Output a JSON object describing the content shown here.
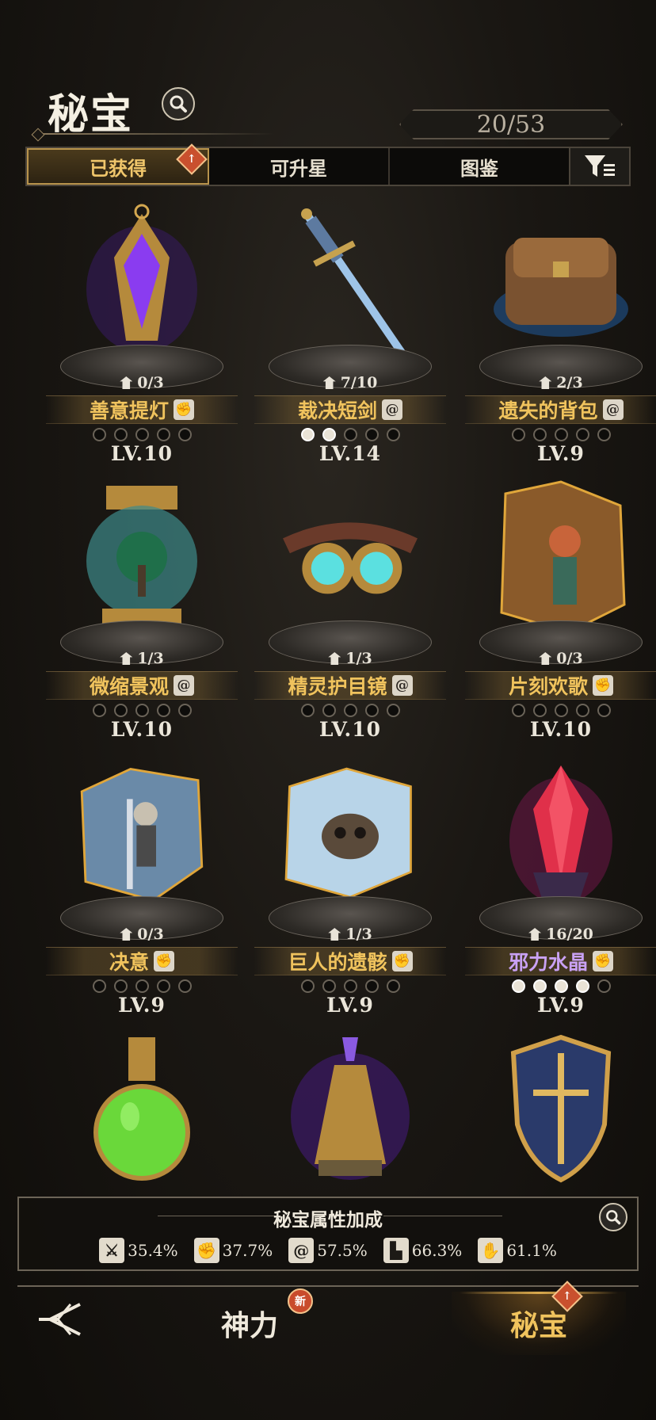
{
  "header": {
    "title": "秘宝",
    "counter": "20/53"
  },
  "tabs": [
    {
      "label": "已获得",
      "active": true,
      "badge": "up-arrow"
    },
    {
      "label": "可升星",
      "active": false
    },
    {
      "label": "图鉴",
      "active": false
    }
  ],
  "treasures": [
    {
      "name": "善意提灯",
      "count": "0/3",
      "level": "LV.10",
      "stars_filled": 0,
      "type_icon": "fist-icon",
      "art": "purple-lantern-art",
      "name_color": "#f0c35d"
    },
    {
      "name": "裁决短剑",
      "count": "7/10",
      "level": "LV.14",
      "stars_filled": 2,
      "type_icon": "spiral-icon",
      "art": "dagger-art",
      "name_color": "#f0c35d"
    },
    {
      "name": "遗失的背包",
      "count": "2/3",
      "level": "LV.9",
      "stars_filled": 0,
      "type_icon": "spiral-icon",
      "art": "backpack-art",
      "name_color": "#f0c35d"
    },
    {
      "name": "微缩景观",
      "count": "1/3",
      "level": "LV.10",
      "stars_filled": 0,
      "type_icon": "spiral-icon",
      "art": "globe-tree-art",
      "name_color": "#f0c35d"
    },
    {
      "name": "精灵护目镜",
      "count": "1/3",
      "level": "LV.10",
      "stars_filled": 0,
      "type_icon": "spiral-icon",
      "art": "goggles-art",
      "name_color": "#f0c35d"
    },
    {
      "name": "片刻欢歌",
      "count": "0/3",
      "level": "LV.10",
      "stars_filled": 0,
      "type_icon": "fist-icon",
      "art": "tavern-shard-art",
      "name_color": "#f0c35d"
    },
    {
      "name": "决意",
      "count": "0/3",
      "level": "LV.9",
      "stars_filled": 0,
      "type_icon": "fist-icon",
      "art": "warrior-shard-art",
      "name_color": "#f0c35d"
    },
    {
      "name": "巨人的遗骸",
      "count": "1/3",
      "level": "LV.9",
      "stars_filled": 0,
      "type_icon": "fist-icon",
      "art": "giant-skull-shard-art",
      "name_color": "#f0c35d"
    },
    {
      "name": "邪力水晶",
      "count": "16/20",
      "level": "LV.9",
      "stars_filled": 4,
      "type_icon": "fist-icon",
      "art": "red-crystal-art",
      "name_color": "#c9a1f4"
    },
    {
      "name": "",
      "count": "",
      "level": "",
      "stars_filled": 0,
      "type_icon": "",
      "art": "green-potion-art",
      "name_color": "#f0c35d"
    },
    {
      "name": "",
      "count": "",
      "level": "",
      "stars_filled": 0,
      "type_icon": "",
      "art": "purple-flask-art",
      "name_color": "#f0c35d"
    },
    {
      "name": "",
      "count": "",
      "level": "",
      "stars_filled": 0,
      "type_icon": "",
      "art": "shield-art",
      "name_color": "#f0c35d"
    }
  ],
  "bonus": {
    "title": "秘宝属性加成",
    "stats": [
      {
        "icon": "sword-icon",
        "value": "35.4%"
      },
      {
        "icon": "fist-icon",
        "value": "37.7%"
      },
      {
        "icon": "spiral-icon",
        "value": "57.5%"
      },
      {
        "icon": "boot-icon",
        "value": "66.3%"
      },
      {
        "icon": "hand-flame-icon",
        "value": "61.1%"
      }
    ]
  },
  "nav": {
    "divine": "神力",
    "divine_badge": "新",
    "treasure": "秘宝"
  }
}
